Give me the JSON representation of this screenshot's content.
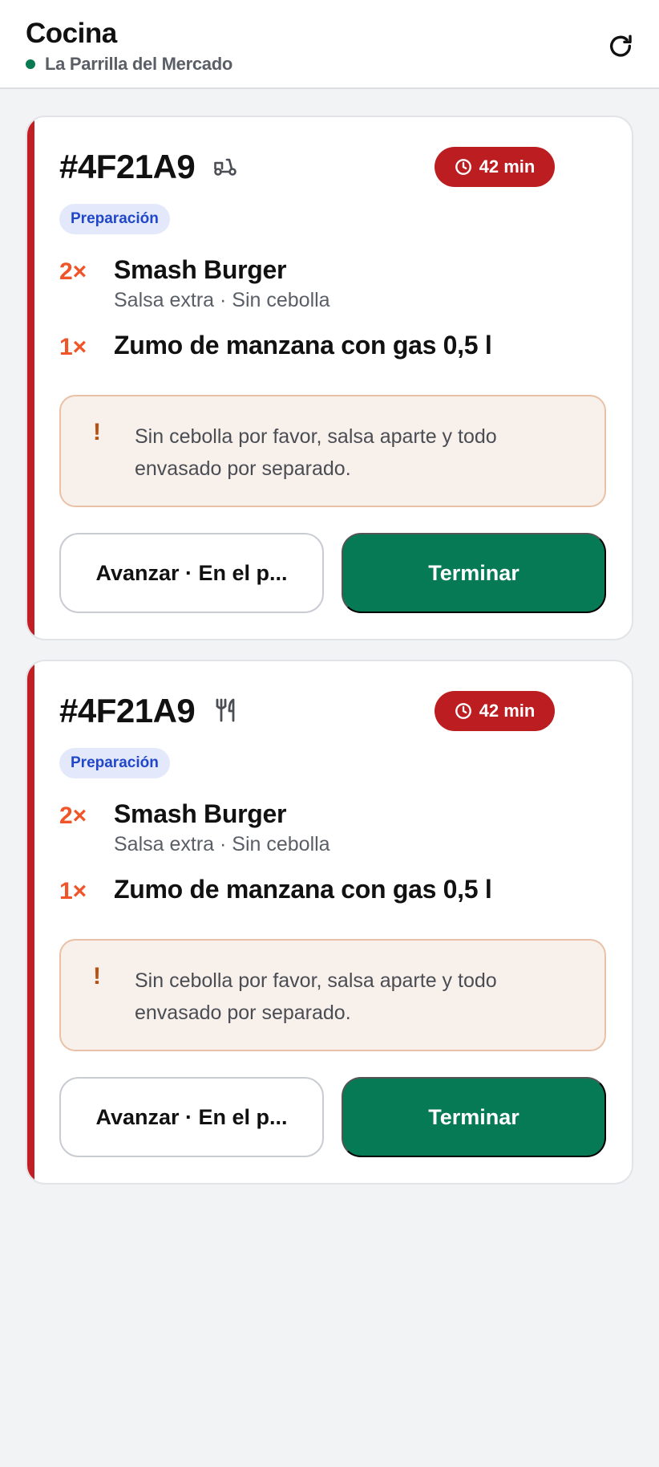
{
  "header": {
    "title": "Cocina",
    "restaurant": "La Parrilla del Mercado",
    "refresh_icon": "refresh-icon"
  },
  "colors": {
    "accent_urgent": "#bb1d20",
    "primary_green": "#067a55",
    "quantity_orange": "#f0552a",
    "badge_blue": "#2147c9"
  },
  "orders": [
    {
      "id": "#4F21A9",
      "type_icon": "scooter-icon",
      "timer": "42 min",
      "stage": "Preparación",
      "items": [
        {
          "qty": "2×",
          "name": "Smash Burger",
          "mods": "Salsa extra · Sin cebolla"
        },
        {
          "qty": "1×",
          "name": "Zumo de manzana con gas 0,5 l"
        }
      ],
      "note": "Sin cebolla por favor, salsa aparte y todo envasado por separado.",
      "advance_label": "Avanzar · En el p...",
      "finish_label": "Terminar"
    },
    {
      "id": "#4F21A9",
      "type_icon": "fork-knife-icon",
      "timer": "42 min",
      "stage": "Preparación",
      "items": [
        {
          "qty": "2×",
          "name": "Smash Burger",
          "mods": "Salsa extra · Sin cebolla"
        },
        {
          "qty": "1×",
          "name": "Zumo de manzana con gas 0,5 l"
        }
      ],
      "note": "Sin cebolla por favor, salsa aparte y todo envasado por separado.",
      "advance_label": "Avanzar · En el p...",
      "finish_label": "Terminar"
    }
  ]
}
